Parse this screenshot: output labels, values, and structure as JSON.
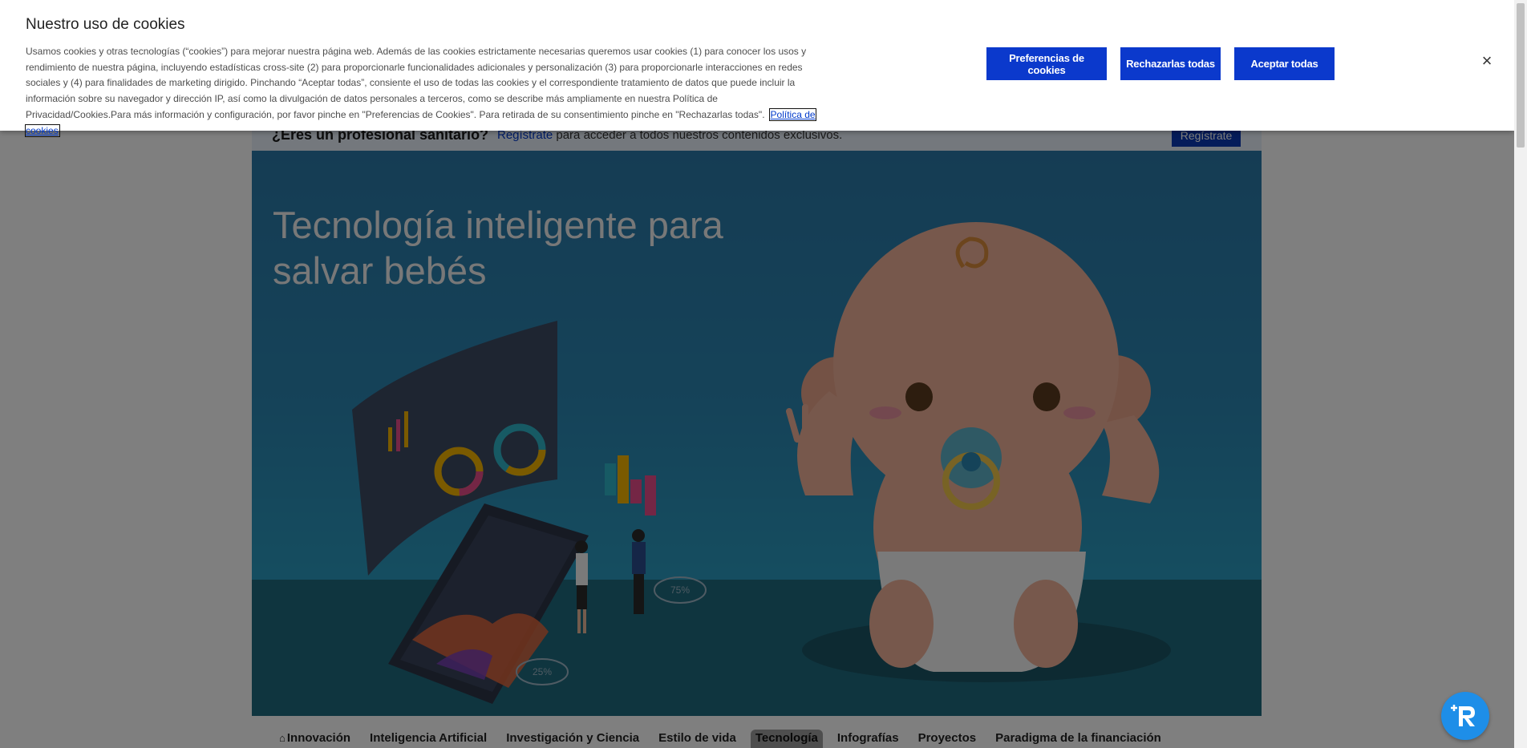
{
  "cookie_banner": {
    "title": "Nuestro uso de cookies",
    "body": "Usamos cookies y otras tecnologías (“cookies”) para mejorar nuestra página web. Además de las cookies estrictamente necesarias queremos usar cookies (1) para conocer los usos y rendimiento de nuestra página, incluyendo estadísticas cross-site (2) para proporcionarle funcionalidades adicionales y personalización (3) para proporcionarle interacciones en redes sociales y (4) para finalidades de marketing dirigido. Pinchando “Aceptar todas”, consiente el uso de todas las cookies y el correspondiente tratamiento de datos que puede incluir la información sobre su navegador y dirección IP, así como la divulgación de datos personales a terceros, como se describe más ampliamente en nuestra Política de Privacidad/Cookies.Para más información y configuración, por favor pinche en \"Preferencias de Cookies\". Para retirada de su consentimiento pinche en \"Rechazarlas todas\".",
    "policy_link": "Política de cookies",
    "buttons": {
      "preferences": "Preferencias de cookies",
      "reject": "Rechazarlas todas",
      "accept": "Aceptar todas"
    },
    "close_icon": "×"
  },
  "register_bar": {
    "question": "¿Eres un profesional sanitario?",
    "link": "Regístrate",
    "text": "para acceder a todos nuestros contenidos exclusivos.",
    "button": "Regístrate"
  },
  "hero": {
    "title": "Tecnología inteligente para salvar bebés",
    "art_labels": {
      "pct_left": "25%",
      "pct_right": "75%"
    }
  },
  "nav_tabs": [
    {
      "label": "Innovación",
      "icon": "home-icon"
    },
    {
      "label": "Inteligencia Artificial"
    },
    {
      "label": "Investigación y Ciencia"
    },
    {
      "label": "Estilo de vida"
    },
    {
      "label": "Tecnología",
      "active": true
    },
    {
      "label": "Infografías"
    },
    {
      "label": "Proyectos"
    },
    {
      "label": "Paradigma de la financiación"
    }
  ],
  "colors": {
    "primary_button": "#0b39cc",
    "hero_bg": "#2a86b2",
    "fab": "#1e8ee8"
  }
}
